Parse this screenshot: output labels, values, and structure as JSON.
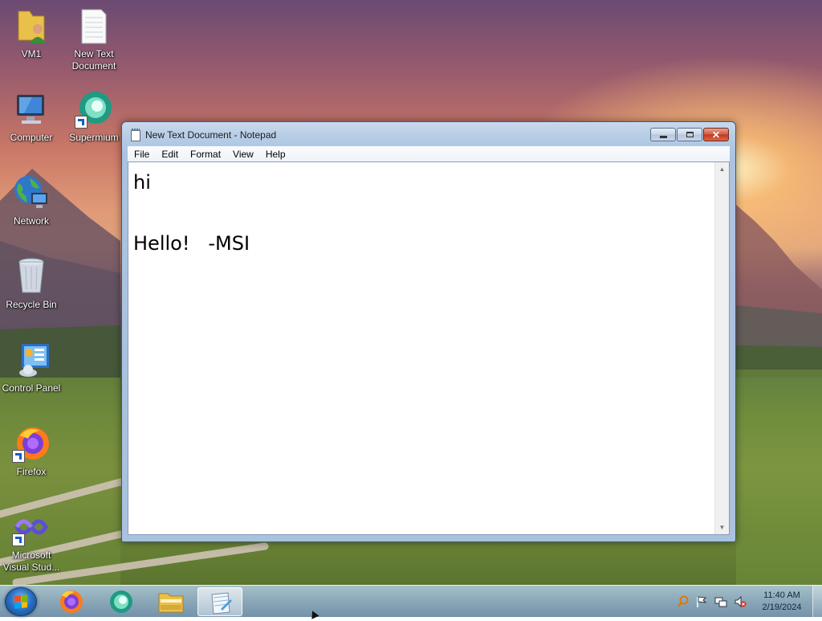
{
  "desktop": {
    "icons": [
      {
        "label": "VM1",
        "icon": "user-folder-icon"
      },
      {
        "label": "New Text Document",
        "icon": "text-document-icon"
      },
      {
        "label": "Computer",
        "icon": "computer-icon"
      },
      {
        "label": "Supermium",
        "icon": "supermium-browser-icon"
      },
      {
        "label": "Network",
        "icon": "network-globe-icon"
      },
      {
        "label": "Recycle Bin",
        "icon": "recycle-bin-icon"
      },
      {
        "label": "Control Panel",
        "icon": "control-panel-icon"
      },
      {
        "label": "Firefox",
        "icon": "firefox-icon"
      },
      {
        "label": "Microsoft Visual Stud...",
        "icon": "visual-studio-icon"
      }
    ]
  },
  "notepad": {
    "title": "New Text Document - Notepad",
    "menu": [
      "File",
      "Edit",
      "Format",
      "View",
      "Help"
    ],
    "content": "hi\n\nHello!   -MSI",
    "buttons": {
      "minimize": "minimize",
      "maximize": "maximize",
      "close": "close"
    }
  },
  "taskbar": {
    "pinned": [
      "firefox-icon",
      "supermium-browser-icon",
      "file-explorer-icon",
      "notepad-icon"
    ],
    "active": "notepad-icon",
    "tray_icons": [
      "search-magnifier-icon",
      "action-center-flag-icon",
      "network-icon",
      "volume-muted-icon"
    ],
    "time": "11:40 AM",
    "date": "2/19/2024"
  }
}
